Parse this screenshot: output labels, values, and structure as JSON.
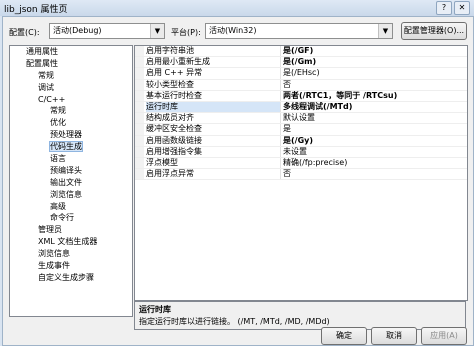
{
  "window": {
    "title": "lib_json 属性页"
  },
  "config": {
    "config_label": "配置(C):",
    "config_value": "活动(Debug)",
    "platform_label": "平台(P):",
    "platform_value": "活动(Win32)",
    "manager_button": "配置管理器(O)..."
  },
  "tree": {
    "nodes": [
      {
        "label": "通用属性"
      },
      {
        "label": "配置属性"
      },
      {
        "label": "常规"
      },
      {
        "label": "调试"
      },
      {
        "label": "C/C++"
      },
      {
        "label": "常规"
      },
      {
        "label": "优化"
      },
      {
        "label": "预处理器"
      },
      {
        "label": "代码生成"
      },
      {
        "label": "语言"
      },
      {
        "label": "预编译头"
      },
      {
        "label": "输出文件"
      },
      {
        "label": "浏览信息"
      },
      {
        "label": "高级"
      },
      {
        "label": "命令行"
      },
      {
        "label": "管理员"
      },
      {
        "label": "XML 文档生成器"
      },
      {
        "label": "浏览信息"
      },
      {
        "label": "生成事件"
      },
      {
        "label": "自定义生成步骤"
      }
    ]
  },
  "properties": [
    {
      "name": "启用字符串池",
      "value": "是(/GF)"
    },
    {
      "name": "启用最小重新生成",
      "value": "是(/Gm)"
    },
    {
      "name": "启用 C++ 异常",
      "value": "是(/EHsc)"
    },
    {
      "name": "较小类型检查",
      "value": "否"
    },
    {
      "name": "基本运行时检查",
      "value": "两者(/RTC1，等同于 /RTCsu)"
    },
    {
      "name": "运行时库",
      "value": "多线程调试(/MTd)"
    },
    {
      "name": "结构成员对齐",
      "value": "默认设置"
    },
    {
      "name": "缓冲区安全检查",
      "value": "是"
    },
    {
      "name": "启用函数级链接",
      "value": "是(/Gy)"
    },
    {
      "name": "启用增强指令集",
      "value": "未设置"
    },
    {
      "name": "浮点模型",
      "value": "精确(/fp:precise)"
    },
    {
      "name": "启用浮点异常",
      "value": "否"
    }
  ],
  "description": {
    "title": "运行时库",
    "text": "指定运行时库以进行链接。    (/MT, /MTd, /MD, /MDd)"
  },
  "buttons": {
    "ok": "确定",
    "cancel": "取消",
    "apply": "应用(A)"
  }
}
